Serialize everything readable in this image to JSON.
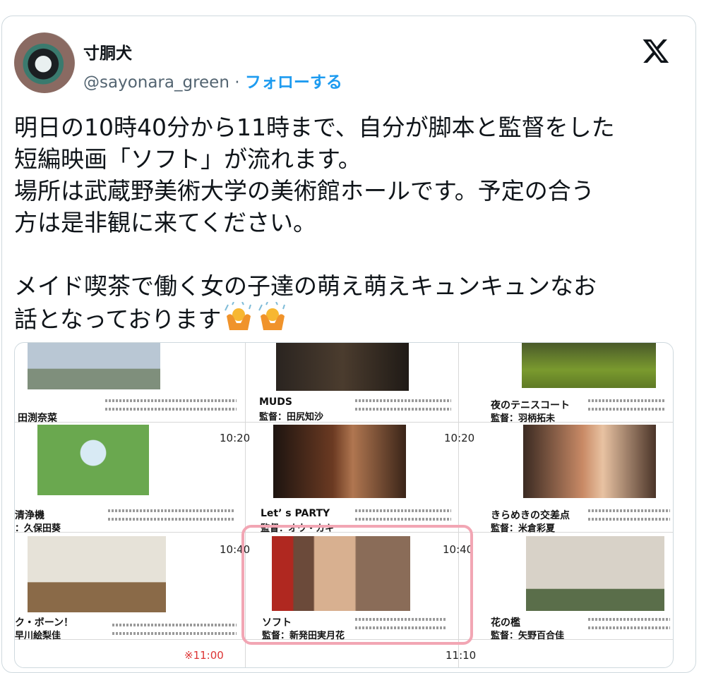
{
  "tweet": {
    "author_name": "寸胴犬",
    "handle": "@sayonara_green",
    "separator": "·",
    "follow_label": "フォローする",
    "text_lines": [
      "明日の10時40分から11時まで、自分が脚本と監督をした",
      "短編映画「ソフト」が流れます。",
      "場所は武蔵野美術大学の美術館ホールです。予定の合う",
      "方は是非観に来てください。",
      "",
      "メイド喫茶で働く女の子達の萌え萌えキュンキュンなお",
      "話となっております"
    ],
    "emoji": [
      "person-raising-hands-emoji",
      "person-raising-hands-emoji"
    ]
  },
  "flyer": {
    "rows": [
      [
        {
          "title": "田渕奈菜",
          "director": "",
          "time": ""
        },
        {
          "title": "MUDS",
          "director": "監督：田尻知沙",
          "time": ""
        },
        {
          "title": "夜のテニスコート",
          "director": "監督：羽柄拓未",
          "time": ""
        }
      ],
      [
        {
          "title": "清浄機",
          "director": "：久保田葵",
          "time": "10:20"
        },
        {
          "title": "Let’ s PARTY",
          "director": "監督：オウ・カキ",
          "time": "10:20"
        },
        {
          "title": "きらめきの交差点",
          "director": "監督：米倉彩夏",
          "time": ""
        }
      ],
      [
        {
          "title": "ク・ボーン！",
          "director": "早川絵梨佳",
          "time": "10:40"
        },
        {
          "title": "ソフト",
          "director": "監督：新発田実月花",
          "time": "10:40"
        },
        {
          "title": "花の檻",
          "director": "監督：矢野百合佳",
          "time": ""
        }
      ]
    ],
    "partial_times": [
      "※11:00",
      "11:10"
    ]
  },
  "colors": {
    "follow": "#1d9bf0",
    "highlight": "#f2a6b4",
    "handle": "#536471"
  }
}
